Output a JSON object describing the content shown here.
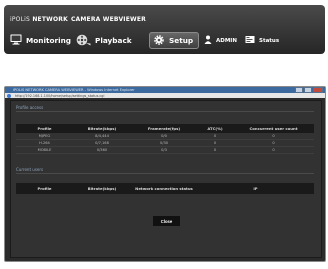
{
  "app": {
    "brand_prefix": "iPOLiS",
    "brand_network": "NETWORK",
    "brand_rest": "CAMERA WEBVIEWER",
    "menu": [
      {
        "label": "Monitoring",
        "icon": "monitor-icon"
      },
      {
        "label": "Playback",
        "icon": "film-reel-icon"
      },
      {
        "label": "Setup",
        "icon": "gear-icon",
        "active": true
      },
      {
        "label": "ADMIN",
        "icon": "user-icon"
      },
      {
        "label": "Status",
        "icon": "status-icon"
      }
    ]
  },
  "popup": {
    "title": "iPOLiS NETWORK CAMERA WEBVIEWER - Windows Internet Explorer",
    "url": "http://192.168.1.100/home/setup/settings_status.cgi",
    "profile_section": "Profile access",
    "profile_headers": [
      "Profile",
      "Bitrate(kbps)",
      "Framerate(fps)",
      "ATC(%)",
      "Concurrent user count"
    ],
    "profile_rows": [
      [
        "MJPEG",
        "8/4,444",
        "0/0",
        "0",
        "0"
      ],
      [
        "H.264",
        "0/7,168",
        "0/30",
        "0",
        "0"
      ],
      [
        "MOBILE",
        "0/360",
        "0/3",
        "0",
        "0"
      ]
    ],
    "users_section": "Current users",
    "users_headers": [
      "Profile",
      "Bitrate(kbps)",
      "Network connection status",
      "IP"
    ],
    "close_label": "Close"
  },
  "colors": {
    "accent": "#3d6a9e",
    "panel": "#323232",
    "header_bg": "#1a1a1a"
  }
}
